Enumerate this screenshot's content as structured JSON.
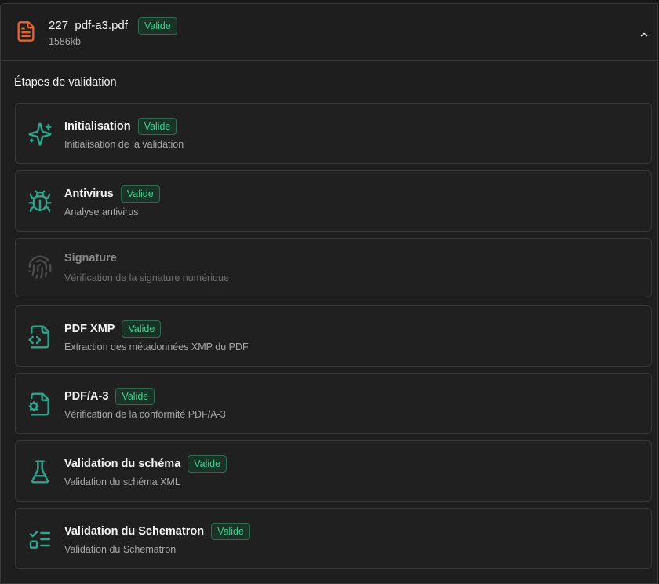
{
  "file": {
    "name": "227_pdf-a3.pdf",
    "size": "1586kb",
    "status": "Valide",
    "icon": "file-text-icon"
  },
  "section_title": "Étapes de validation",
  "colors": {
    "accent": "#3ecf8e",
    "file_icon": "#e8622c",
    "step_icon": "#2fa58c",
    "step_icon_muted": "#4a4a4a"
  },
  "steps": [
    {
      "title": "Initialisation",
      "description": "Initialisation de la validation",
      "status": "Valide",
      "icon": "sparkles-icon"
    },
    {
      "title": "Antivirus",
      "description": "Analyse antivirus",
      "status": "Valide",
      "icon": "bug-icon"
    },
    {
      "title": "Signature",
      "description": "Vérification de la signature numérique",
      "status": "",
      "icon": "fingerprint-icon"
    },
    {
      "title": "PDF XMP",
      "description": "Extraction des métadonnées XMP du PDF",
      "status": "Valide",
      "icon": "file-code-icon"
    },
    {
      "title": "PDF/A-3",
      "description": "Vérification de la conformité PDF/A-3",
      "status": "Valide",
      "icon": "file-cog-icon"
    },
    {
      "title": "Validation du schéma",
      "description": "Validation du schéma XML",
      "status": "Valide",
      "icon": "flask-icon"
    },
    {
      "title": "Validation du Schematron",
      "description": "Validation du Schematron",
      "status": "Valide",
      "icon": "list-checks-icon"
    }
  ]
}
